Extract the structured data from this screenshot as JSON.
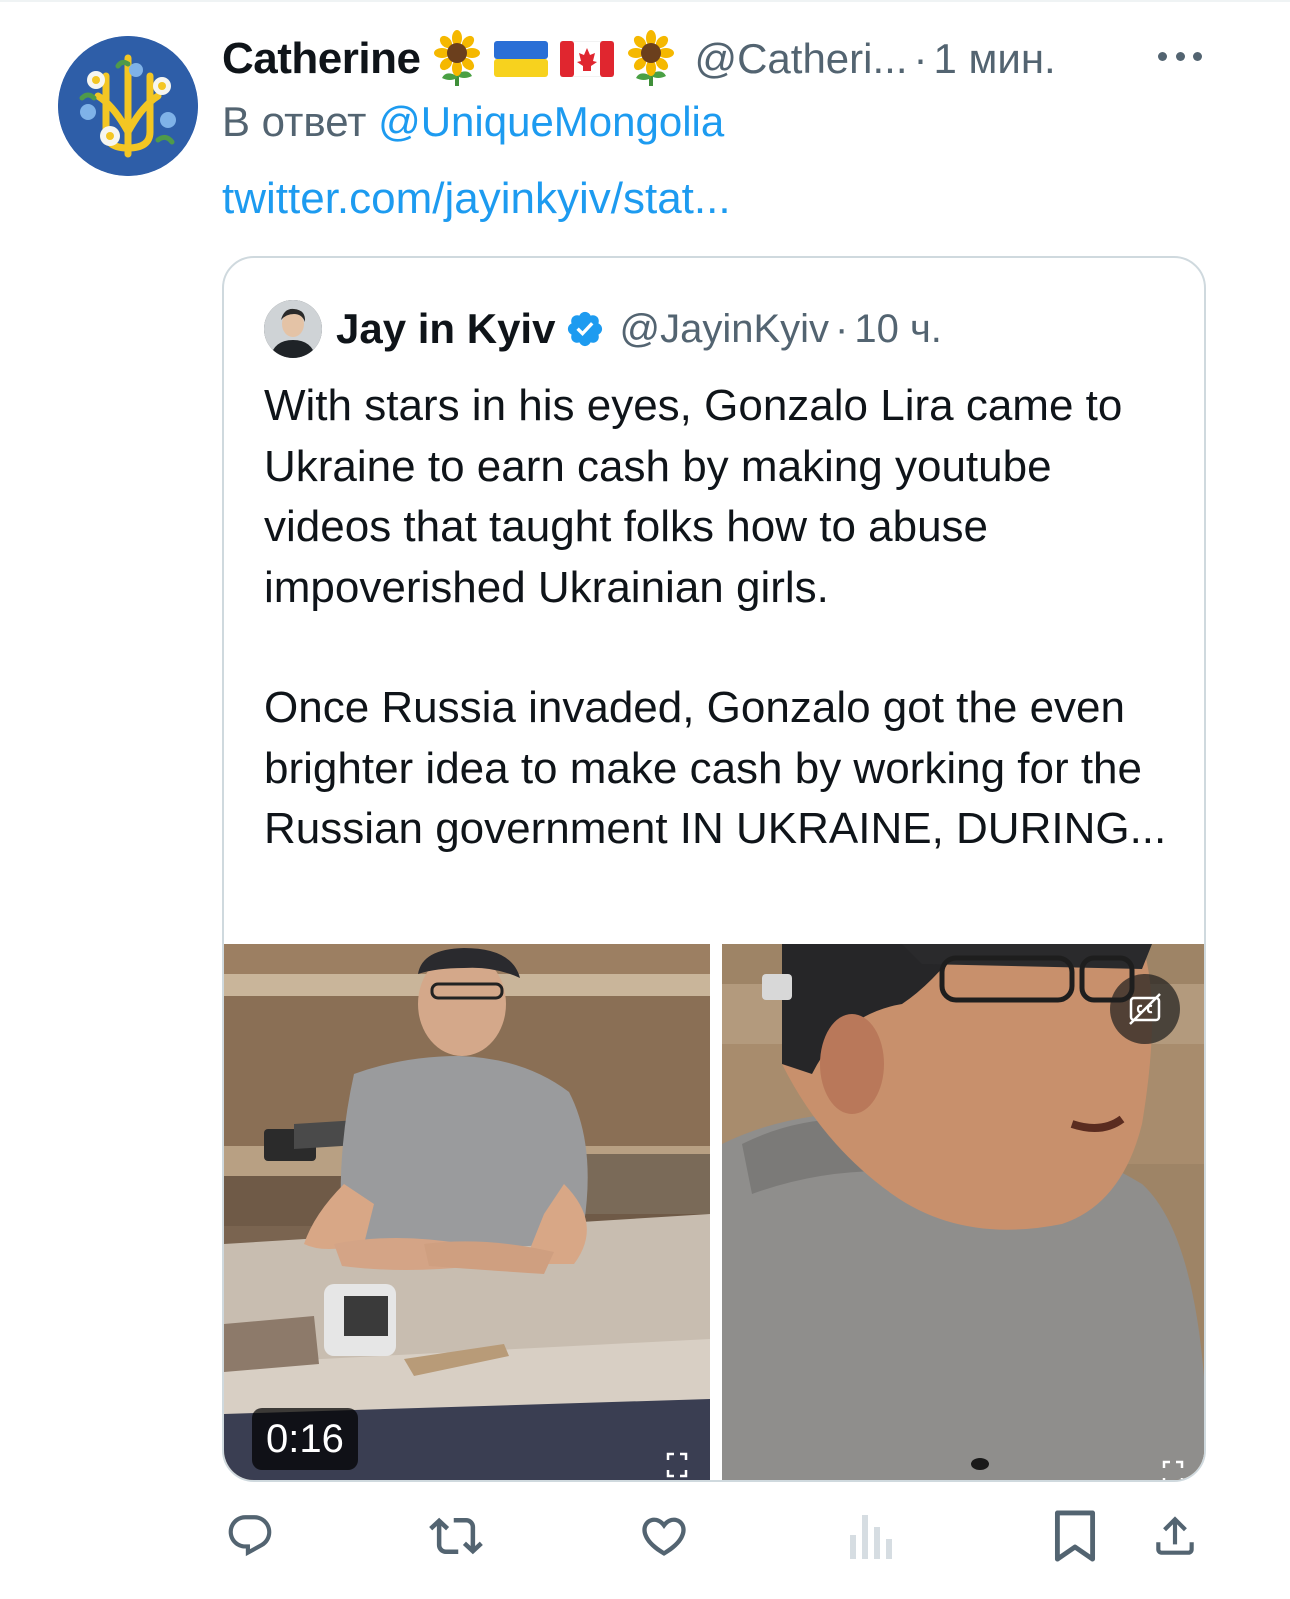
{
  "tweet": {
    "author_name": "Catherine",
    "author_emojis": [
      "🌻",
      "🇺🇦",
      "🇨🇦",
      "🌻"
    ],
    "handle": "@Catheri...",
    "separator": "·",
    "time": "1 мин.",
    "reply_prefix": "В ответ",
    "reply_mention": "@UniqueMongolia",
    "link_text": "twitter.com/jayinkyiv/stat..."
  },
  "quote": {
    "author_name": "Jay in Kyiv",
    "handle": "@JayinKyiv",
    "separator": "·",
    "time": "10 ч.",
    "paragraph_1": "With stars in his eyes, Gonzalo Lira came to Ukraine to earn cash by making youtube videos that taught folks how to abuse impoverished Ukrainian girls.",
    "paragraph_2": "Once Russia invaded, Gonzalo got the even brighter idea to make cash by working for the Russian government IN UKRAINE, DURING...",
    "video_duration": "0:16"
  },
  "colors": {
    "link": "#1d9bf0",
    "secondary_text": "#536471",
    "primary_text": "#0f1419",
    "border": "#cfd9de"
  },
  "icons": {
    "more": "more-dots-icon",
    "verified": "verified-badge-icon",
    "reply": "reply-bubble-icon",
    "retweet": "retweet-icon",
    "like": "heart-icon",
    "views": "views-bar-icon",
    "bookmark": "bookmark-icon",
    "share": "share-icon",
    "captions": "captions-icon",
    "expand": "expand-icon"
  }
}
